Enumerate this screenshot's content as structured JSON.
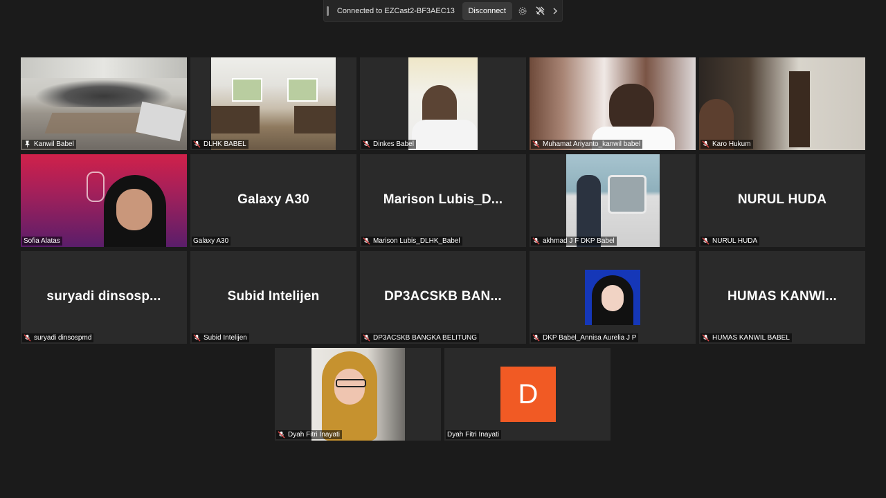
{
  "castbar": {
    "status": "Connected to EZCast2-BF3AEC13",
    "disconnect_label": "Disconnect"
  },
  "participants": [
    {
      "label": "Kanwil Babel",
      "muted": false,
      "pinned": true,
      "active": true
    },
    {
      "label": "DLHK BABEL",
      "muted": true
    },
    {
      "label": "Dinkes Babel",
      "muted": true
    },
    {
      "label": "Muhamat Ariyanto_kanwil babel",
      "muted": true
    },
    {
      "label": "Karo Hukum",
      "muted": true
    },
    {
      "label": "Sofia Alatas",
      "muted": false
    },
    {
      "label": "Galaxy A30",
      "display_name": "Galaxy A30",
      "muted": false
    },
    {
      "label": "Marison Lubis_DLHK_Babel",
      "display_name": "Marison  Lubis_D...",
      "muted": true
    },
    {
      "label": "akhmad J F DKP Babel",
      "muted": true
    },
    {
      "label": "NURUL HUDA",
      "display_name": "NURUL HUDA",
      "muted": true
    },
    {
      "label": "suryadi dinsospmd",
      "display_name": "suryadi  dinsosp...",
      "muted": true
    },
    {
      "label": "Subid Intelijen",
      "display_name": "Subid Intelijen",
      "muted": true
    },
    {
      "label": "DP3ACSKB BANGKA BELITUNG",
      "display_name": "DP3ACSKB  BAN...",
      "muted": true
    },
    {
      "label": "DKP Babel_Annisa Aurelia J P",
      "muted": true
    },
    {
      "label": "HUMAS KANWIL BABEL",
      "display_name": "HUMAS  KANWI...",
      "muted": true
    },
    {
      "label": "Dyah Fitri Inayati",
      "muted": true
    },
    {
      "label": "Dyah Fitri Inayati",
      "avatar_letter": "D",
      "muted": false
    }
  ],
  "colors": {
    "background": "#1b1b1b",
    "tile": "#2a2a2a",
    "active_border": "#c6e86a",
    "mute_red": "#e04848",
    "avatar": "#f15a24"
  },
  "icons": [
    "settings-icon",
    "stop-casting-icon",
    "chevron-right-icon",
    "mic-off-icon",
    "pin-icon"
  ]
}
